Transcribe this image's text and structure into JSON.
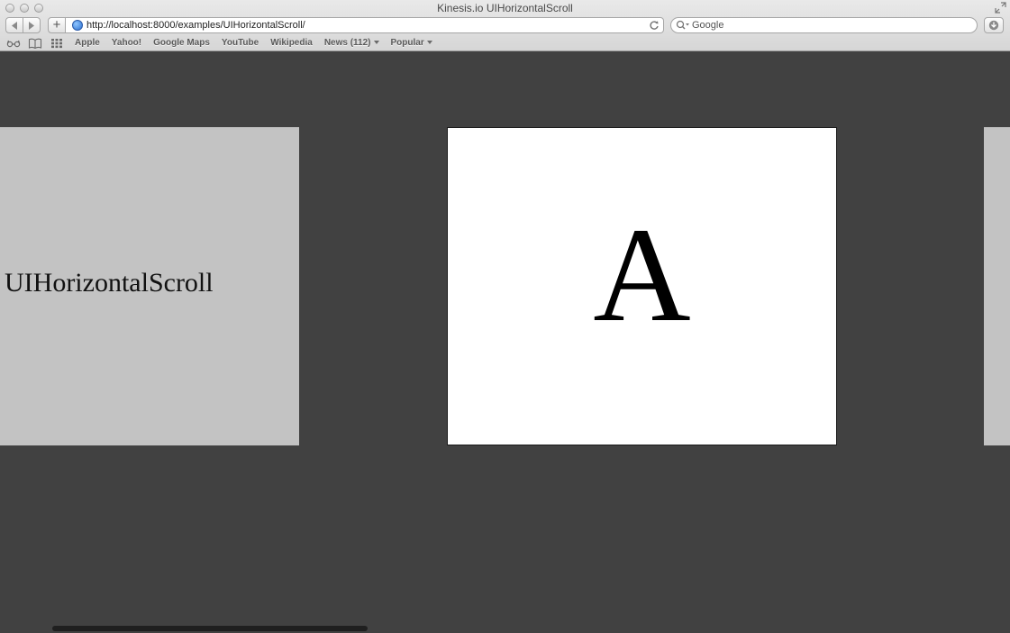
{
  "window": {
    "title": "Kinesis.io UIHorizontalScroll"
  },
  "toolbar": {
    "add_label": "+",
    "url": "http://localhost:8000/examples/UIHorizontalScroll/",
    "search_placeholder": "Google"
  },
  "bookmarks": {
    "items": [
      {
        "label": "Apple"
      },
      {
        "label": "Yahoo!"
      },
      {
        "label": "Google Maps"
      },
      {
        "label": "YouTube"
      },
      {
        "label": "Wikipedia"
      },
      {
        "label": "News (112)",
        "has_dropdown": true
      },
      {
        "label": "Popular",
        "has_dropdown": true
      }
    ]
  },
  "content": {
    "left_panel_title": "UIHorizontalScroll",
    "center_slide_letter": "A"
  },
  "colors": {
    "background": "#414141",
    "side_panel": "#c3c3c3",
    "center_panel": "#ffffff"
  }
}
